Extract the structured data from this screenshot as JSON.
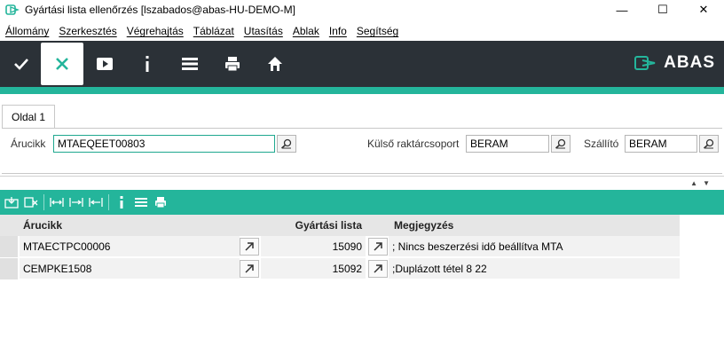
{
  "window": {
    "title": "Gyártási lista ellenőrzés  [lszabados@abas-HU-DEMO-M]",
    "minimize_glyph": "—",
    "maximize_glyph": "☐",
    "close_glyph": "✕"
  },
  "menu": [
    "Állomány",
    "Szerkesztés",
    "Végrehajtás",
    "Táblázat",
    "Utasítás",
    "Ablak",
    "Info",
    "Segítség"
  ],
  "toolbar": {
    "icons": [
      "check-icon",
      "close-icon",
      "play-icon",
      "info-icon",
      "menu-icon",
      "print-icon",
      "home-icon"
    ],
    "logo_text": "ABAS"
  },
  "tabs": [
    {
      "label": "Oldal 1"
    }
  ],
  "form": {
    "article_label": "Árucikk",
    "article_value": "MTAEQEET00803",
    "warehouse_label": "Külső raktárcsoport",
    "warehouse_value": "BERAM",
    "supplier_label": "Szállító",
    "supplier_value": "BERAM"
  },
  "table": {
    "columns": [
      "Árucikk",
      "Gyártási lista",
      "Megjegyzés"
    ],
    "rows": [
      {
        "article": "MTAECTPC00006",
        "list": "15090",
        "note": "; Nincs beszerzési idő beállítva MTA"
      },
      {
        "article": "CEMPKE1508",
        "list": "15092",
        "note": ";Duplázott tétel 8 22"
      }
    ]
  },
  "colors": {
    "accent": "#24b59b",
    "toolbar_bg": "#2b3137"
  }
}
